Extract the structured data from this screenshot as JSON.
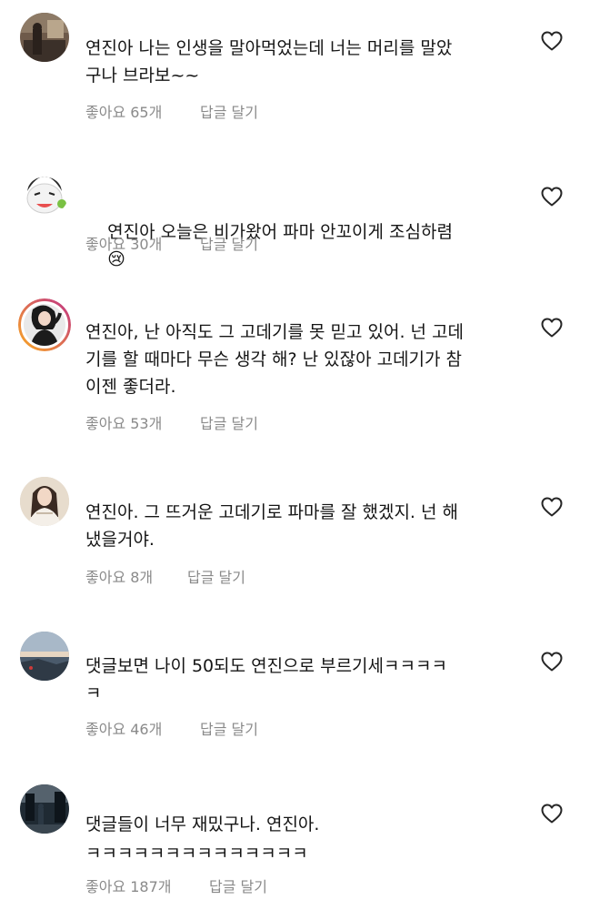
{
  "colors": {
    "text": "#151515",
    "meta": "#8a8a8a",
    "heart_outline": "#262626",
    "story_ring_start": "#f9a825",
    "story_ring_end": "#c13584"
  },
  "comments": [
    {
      "avatar": "avatar-photo-icon",
      "text": "연진아 나는 인생을 말아먹었는데 너는 머리를 말았\n구나 브라보~~",
      "likes": "좋아요 65개",
      "reply": "답글 달기",
      "like_icon": "heart-outline-icon"
    },
    {
      "avatar": "avatar-cartoon-icon",
      "text": "연진아 오늘은 비가왔어 파마 안꼬이게 조심하렴",
      "emoji": "😢",
      "likes": "좋아요 30개",
      "reply": "답글 달기",
      "like_icon": "heart-outline-icon"
    },
    {
      "avatar": "avatar-story-ring-icon",
      "text": "연진아, 난 아직도 그 고데기를 못 믿고 있어. 넌 고데\n기를 할 때마다 무슨 생각 해? 난 있잖아 고데기가 참\n이젠 좋더라.",
      "likes": "좋아요 53개",
      "reply": "답글 달기",
      "like_icon": "heart-outline-icon"
    },
    {
      "avatar": "avatar-person-icon",
      "text": "연진아. 그 뜨거운 고데기로 파마를 잘 했겠지. 넌 해\n냈을거야.",
      "likes": "좋아요 8개",
      "reply": "답글 달기",
      "like_icon": "heart-outline-icon"
    },
    {
      "avatar": "avatar-landscape-icon",
      "text": "댓글보면 나이 50되도 연진으로 부르기세ㅋㅋㅋㅋ\nㅋ",
      "likes": "좋아요 46개",
      "reply": "답글 달기",
      "like_icon": "heart-outline-icon"
    },
    {
      "avatar": "avatar-street-icon",
      "text": "댓글들이 너무 재밌구나. 연진아.\nㅋㅋㅋㅋㅋㅋㅋㅋㅋㅋㅋㅋㅋㅋ",
      "likes": "좋아요 187개",
      "reply": "답글 달기",
      "like_icon": "heart-outline-icon"
    }
  ]
}
